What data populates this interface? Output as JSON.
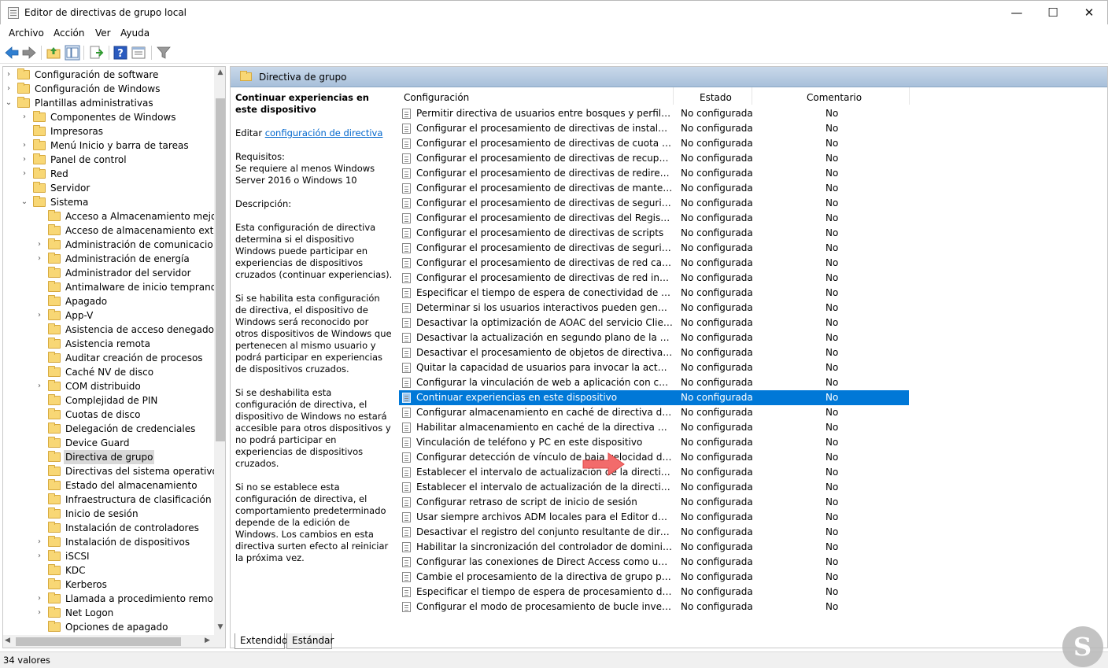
{
  "window": {
    "title": "Editor de directivas de grupo local",
    "controls": {
      "minimize": "—",
      "maximize": "☐",
      "close": "✕"
    }
  },
  "menu": [
    "Archivo",
    "Acción",
    "Ver",
    "Ayuda"
  ],
  "toolbar": [
    "back-icon",
    "forward-icon",
    "up-folder-icon",
    "show-hide-tree-icon",
    "export-list-icon",
    "help-icon",
    "properties-icon",
    "filter-icon"
  ],
  "tree": {
    "items": [
      {
        "label": "Configuración de software",
        "level": 1,
        "chevron": "›"
      },
      {
        "label": "Configuración de Windows",
        "level": 1,
        "chevron": "›"
      },
      {
        "label": "Plantillas administrativas",
        "level": 1,
        "chevron": "⌄"
      },
      {
        "label": "Componentes de Windows",
        "level": 2,
        "chevron": "›"
      },
      {
        "label": "Impresoras",
        "level": 2,
        "chevron": ""
      },
      {
        "label": "Menú Inicio y barra de tareas",
        "level": 2,
        "chevron": "›"
      },
      {
        "label": "Panel de control",
        "level": 2,
        "chevron": "›"
      },
      {
        "label": "Red",
        "level": 2,
        "chevron": "›"
      },
      {
        "label": "Servidor",
        "level": 2,
        "chevron": ""
      },
      {
        "label": "Sistema",
        "level": 2,
        "chevron": "⌄"
      },
      {
        "label": "Acceso a Almacenamiento mejo",
        "level": 3,
        "chevron": ""
      },
      {
        "label": "Acceso de almacenamiento extr",
        "level": 3,
        "chevron": ""
      },
      {
        "label": "Administración de comunicacio",
        "level": 3,
        "chevron": "›"
      },
      {
        "label": "Administración de energía",
        "level": 3,
        "chevron": "›"
      },
      {
        "label": "Administrador del servidor",
        "level": 3,
        "chevron": ""
      },
      {
        "label": "Antimalware de inicio temprano",
        "level": 3,
        "chevron": ""
      },
      {
        "label": "Apagado",
        "level": 3,
        "chevron": ""
      },
      {
        "label": "App-V",
        "level": 3,
        "chevron": "›"
      },
      {
        "label": "Asistencia de acceso denegado",
        "level": 3,
        "chevron": ""
      },
      {
        "label": "Asistencia remota",
        "level": 3,
        "chevron": ""
      },
      {
        "label": "Auditar creación de procesos",
        "level": 3,
        "chevron": ""
      },
      {
        "label": "Caché NV de disco",
        "level": 3,
        "chevron": ""
      },
      {
        "label": "COM distribuido",
        "level": 3,
        "chevron": "›"
      },
      {
        "label": "Complejidad de PIN",
        "level": 3,
        "chevron": ""
      },
      {
        "label": "Cuotas de disco",
        "level": 3,
        "chevron": ""
      },
      {
        "label": "Delegación de credenciales",
        "level": 3,
        "chevron": ""
      },
      {
        "label": "Device Guard",
        "level": 3,
        "chevron": ""
      },
      {
        "label": "Directiva de grupo",
        "level": 3,
        "chevron": "",
        "selected": true
      },
      {
        "label": "Directivas del sistema operativo",
        "level": 3,
        "chevron": ""
      },
      {
        "label": "Estado del almacenamiento",
        "level": 3,
        "chevron": ""
      },
      {
        "label": "Infraestructura de clasificación d",
        "level": 3,
        "chevron": ""
      },
      {
        "label": "Inicio de sesión",
        "level": 3,
        "chevron": ""
      },
      {
        "label": "Instalación de controladores",
        "level": 3,
        "chevron": ""
      },
      {
        "label": "Instalación de dispositivos",
        "level": 3,
        "chevron": "›"
      },
      {
        "label": "iSCSI",
        "level": 3,
        "chevron": "›"
      },
      {
        "label": "KDC",
        "level": 3,
        "chevron": ""
      },
      {
        "label": "Kerberos",
        "level": 3,
        "chevron": ""
      },
      {
        "label": "Llamada a procedimiento remo",
        "level": 3,
        "chevron": "›"
      },
      {
        "label": "Net Logon",
        "level": 3,
        "chevron": "›"
      },
      {
        "label": "Opciones de apagado",
        "level": 3,
        "chevron": ""
      }
    ]
  },
  "right_header": "Directiva de grupo",
  "description": {
    "title": "Continuar experiencias en este dispositivo",
    "edit_prefix": "Editar ",
    "edit_link": "configuración de directiva",
    "req_label": "Requisitos:",
    "req_text": "Se requiere al menos Windows Server 2016 o Windows 10",
    "desc_label": "Descripción:",
    "p1": "Esta configuración de directiva determina si el dispositivo Windows puede participar en experiencias de dispositivos cruzados (continuar experiencias).",
    "p2": "Si se habilita esta configuración de directiva, el dispositivo de Windows será reconocido por otros dispositivos de Windows que pertenecen al mismo usuario y podrá participar en experiencias de dispositivos cruzados.",
    "p3": "Si se deshabilita esta configuración de directiva, el dispositivo de Windows no estará accesible para otros dispositivos y no podrá participar en experiencias de dispositivos cruzados.",
    "p4": "Si no se establece esta configuración de directiva, el comportamiento predeterminado depende de la edición de Windows. Los cambios en esta directiva surten efecto al reiniciar la próxima vez."
  },
  "columns": {
    "config": "Configuración",
    "estado": "Estado",
    "comentario": "Comentario"
  },
  "rows": [
    {
      "name": "Permitir directiva de usuarios entre bosques y perfiles de us...",
      "estado": "No configurada",
      "comentario": "No"
    },
    {
      "name": "Configurar el procesamiento de directivas de instalación de ...",
      "estado": "No configurada",
      "comentario": "No"
    },
    {
      "name": "Configurar el procesamiento de directivas de cuota de disco",
      "estado": "No configurada",
      "comentario": "No"
    },
    {
      "name": "Configurar el procesamiento de directivas de recuperación E...",
      "estado": "No configurada",
      "comentario": "No"
    },
    {
      "name": "Configurar el procesamiento de directivas de redirección de ...",
      "estado": "No configurada",
      "comentario": "No"
    },
    {
      "name": "Configurar el procesamiento de directivas de mantenimient...",
      "estado": "No configurada",
      "comentario": "No"
    },
    {
      "name": "Configurar el procesamiento de directivas de seguridad IP",
      "estado": "No configurada",
      "comentario": "No"
    },
    {
      "name": "Configurar el procesamiento de directivas del Registro",
      "estado": "No configurada",
      "comentario": "No"
    },
    {
      "name": "Configurar el procesamiento de directivas de scripts",
      "estado": "No configurada",
      "comentario": "No"
    },
    {
      "name": "Configurar el procesamiento de directivas de seguridad",
      "estado": "No configurada",
      "comentario": "No"
    },
    {
      "name": "Configurar el procesamiento de directivas de red cableada",
      "estado": "No configurada",
      "comentario": "No"
    },
    {
      "name": "Configurar el procesamiento de directivas de red inalámbrica",
      "estado": "No configurada",
      "comentario": "No"
    },
    {
      "name": "Especificar el tiempo de espera de conectividad de área de tr...",
      "estado": "No configurada",
      "comentario": "No"
    },
    {
      "name": "Determinar si los usuarios interactivos pueden generar datos...",
      "estado": "No configurada",
      "comentario": "No"
    },
    {
      "name": "Desactivar la optimización de AOAC del servicio Cliente de l...",
      "estado": "No configurada",
      "comentario": "No"
    },
    {
      "name": "Desactivar la actualización en segundo plano de la directiva ...",
      "estado": "No configurada",
      "comentario": "No"
    },
    {
      "name": "Desactivar el procesamiento de objetos de directiva de grup...",
      "estado": "No configurada",
      "comentario": "No"
    },
    {
      "name": "Quitar la capacidad de usuarios para invocar la actualización...",
      "estado": "No configurada",
      "comentario": "No"
    },
    {
      "name": "Configurar la vinculación de web a aplicación con controlad...",
      "estado": "No configurada",
      "comentario": "No"
    },
    {
      "name": "Continuar experiencias en este dispositivo",
      "estado": "No configurada",
      "comentario": "No",
      "selected": true
    },
    {
      "name": "Configurar almacenamiento en caché de directiva de grupo",
      "estado": "No configurada",
      "comentario": "No"
    },
    {
      "name": "Habilitar almacenamiento en caché de la directiva de grupo ...",
      "estado": "No configurada",
      "comentario": "No"
    },
    {
      "name": "Vinculación de teléfono y PC en este dispositivo",
      "estado": "No configurada",
      "comentario": "No"
    },
    {
      "name": "Configurar detección de vínculo de baja velocidad de la dire...",
      "estado": "No configurada",
      "comentario": "No"
    },
    {
      "name": "Establecer el intervalo de actualización de la directiva de gru...",
      "estado": "No configurada",
      "comentario": "No"
    },
    {
      "name": "Establecer el intervalo de actualización de la directiva de gru...",
      "estado": "No configurada",
      "comentario": "No"
    },
    {
      "name": "Configurar retraso de script de inicio de sesión",
      "estado": "No configurada",
      "comentario": "No"
    },
    {
      "name": "Usar siempre archivos ADM locales para el Editor de objetos ...",
      "estado": "No configurada",
      "comentario": "No"
    },
    {
      "name": "Desactivar el registro del conjunto resultante de directivas",
      "estado": "No configurada",
      "comentario": "No"
    },
    {
      "name": "Habilitar la sincronización del controlador de dominio de A...",
      "estado": "No configurada",
      "comentario": "No"
    },
    {
      "name": "Configurar las conexiones de Direct Access como una conex...",
      "estado": "No configurada",
      "comentario": "No"
    },
    {
      "name": "Cambie el procesamiento de la directiva de grupo para que ...",
      "estado": "No configurada",
      "comentario": "No"
    },
    {
      "name": "Especificar el tiempo de espera de procesamiento de directi...",
      "estado": "No configurada",
      "comentario": "No"
    },
    {
      "name": "Configurar el modo de procesamiento de bucle invertido de...",
      "estado": "No configurada",
      "comentario": "No"
    }
  ],
  "tabs": [
    "Extendido",
    "Estándar"
  ],
  "status": "34 valores",
  "colors": {
    "selection": "#0078d7",
    "header_gradient": "#a8c0da",
    "annotation_arrow": "#f26b6b"
  }
}
